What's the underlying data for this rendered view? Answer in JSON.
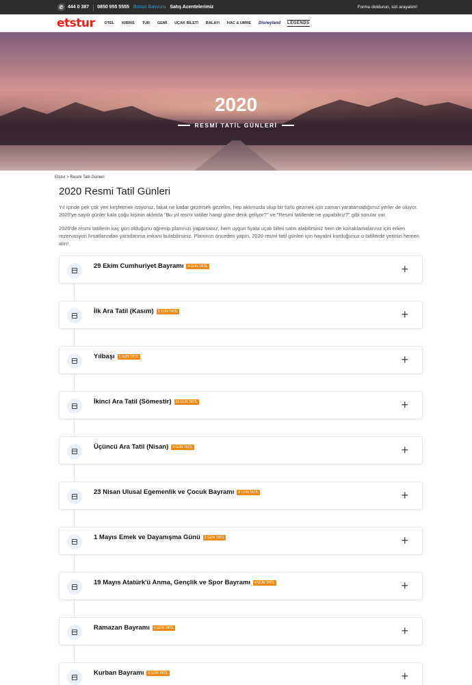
{
  "topbar": {
    "phone1": "444 0 387",
    "phone2": "0850 955 5555",
    "bonus": "Bonus Basvuru",
    "agents": "Satış Acentelerimiz",
    "form_cta": "Formu doldurun, sizi arayalım!"
  },
  "nav": {
    "logo": "etstur",
    "items": [
      "OTEL",
      "KIBRIS",
      "TUR",
      "GEMİ",
      "UÇAK BİLETİ",
      "BALAYI",
      "HAC & UMRE"
    ],
    "disneyland": "Disneyland",
    "legends": "LEGENDS"
  },
  "hero": {
    "title": "2020",
    "subtitle": "RESMİ TATİL GÜNLERİ"
  },
  "breadcrumb": "Etstur > Resmi Tatil Günleri",
  "main": {
    "title": "2020 Resmi Tatil Günleri",
    "paragraphs": [
      "Yıl içinde pek çok yeri keşfetmek istiyoruz, fakat ne kadar gezersek gezelim, hep aklımızda olup bir türlü gezmek için zaman yaratamadığımız yerler de oluyor. 2020'ye sayılı günler kala çoğu kişinin aklında \"Bu yıl resmi tatiller hangi güne denk geliyor?\" ve \"Resmi tatillerde ne yapabiliriz?\" gibi sorular var.",
      "2020'de resmi tatillerin kaç gün olduğunu öğrenip planınızı yaparsanız, hem uygun fiyata uçak bileti satın alabilirsiniz hem de konaklamalarınız için erken rezervasyon fırsatlarından yararlanma imkanı bulabilirsiniz. Planınızı önceden yapın, 2020 resmi tatil günleri için hayalini kurduğunuz o tatillerde yerinizi hemen alın!"
    ]
  },
  "holidays": [
    {
      "name": "29 Ekim Cumhuriyet Bayramı",
      "badge": "4 GÜN TATİL"
    },
    {
      "name": "İlk Ara Tatil (Kasım)",
      "badge": "9 GÜN TATİL"
    },
    {
      "name": "Yılbaşı",
      "badge": "1 GÜN TATİL"
    },
    {
      "name": "İkinci Ara Tatil (Sömestir)",
      "badge": "16 GÜN TATİL"
    },
    {
      "name": "Üçüncü Ara Tatil (Nisan)",
      "badge": "9 GÜN TATİL"
    },
    {
      "name": "23 Nisan Ulusal Egemenlik ve Çocuk Bayramı",
      "badge": "4 GÜN TATİL"
    },
    {
      "name": "1 Mayıs Emek ve Dayanışma Günü",
      "badge": "3 GÜN TATİL"
    },
    {
      "name": "19 Mayıs Atatürk'ü Anma, Gençlik ve Spor Bayramı",
      "badge": "4 GÜN TATİL"
    },
    {
      "name": "Ramazan Bayramı",
      "badge": "4 GÜN TATİL"
    },
    {
      "name": "Kurban Bayramı",
      "badge": "5 GÜN TATİL"
    }
  ]
}
